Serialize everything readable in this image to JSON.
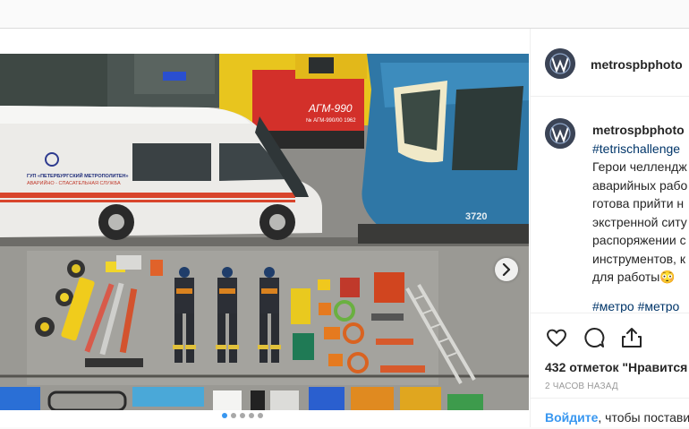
{
  "post": {
    "carousel": {
      "dot_count": 5,
      "active_index": 0
    },
    "icons": {
      "next": "chevron-right-icon",
      "like": "heart-icon",
      "comment": "speech-bubble-icon",
      "share": "share-icon"
    }
  },
  "header": {
    "username": "metrospbphoto"
  },
  "comment": {
    "username": "metrospbphoto",
    "hashtag": "#tetrischallenge",
    "lines": [
      "Герои челлендж",
      "аварийных рабо",
      "готова прийти н",
      "экстренной ситу",
      "распоряжении с",
      "инструментов, к",
      "для работы😳"
    ],
    "tags": [
      "#метро",
      "#метро"
    ]
  },
  "stats": {
    "likes": "432 отметок \"Нравится",
    "time": "2 ЧАСОВ НАЗАД"
  },
  "login_prompt": {
    "link": "Войдите",
    "text": ", чтобы постави"
  },
  "photo_text": {
    "van_line1": "ГУП «ПЕТЕРБУРГСКИЙ МЕТРОПОЛИТЕН»",
    "van_line2": "АВАРИЙНО - СПАСАТЕЛЬНАЯ СЛУЖБА",
    "loco_plate": "АГМ-990",
    "loco_sub": "№ АГМ-990/00 1962",
    "car_number": "3720"
  },
  "colors": {
    "link": "#3897f0",
    "hashtag": "#003569",
    "van_stripe": "#d8452c",
    "train": "#2f77a6"
  }
}
